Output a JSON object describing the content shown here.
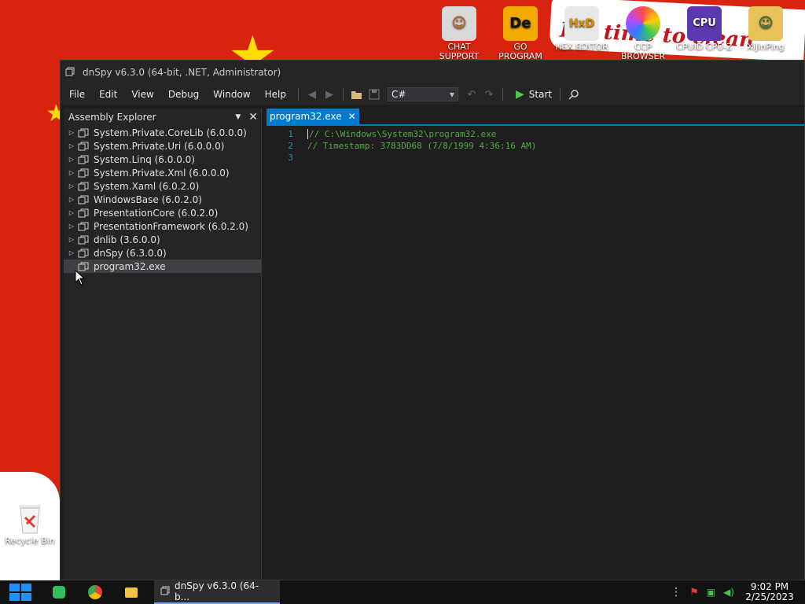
{
  "desktop": {
    "wallpaper_text": "It's time to clean",
    "icons": [
      {
        "label": "CHAT SUPPORT",
        "glyph": "☺",
        "color": "#d9d9d9"
      },
      {
        "label": "GO PROGRAM DIE VIEWER",
        "glyph": "De",
        "color": "#f2a900"
      },
      {
        "label": "HEX EDITOR",
        "glyph": "HxD",
        "color": "#e8e8e8"
      },
      {
        "label": "CCP BROWSER",
        "glyph": "◉",
        "color": "#ff9a2e"
      },
      {
        "label": "CPUID CPU-Z",
        "glyph": "CPU",
        "color": "#5b3ab0"
      },
      {
        "label": "XiJinPing",
        "glyph": "☺",
        "color": "#e8c15a"
      }
    ],
    "recycle_bin": "Recycle Bin"
  },
  "taskbar": {
    "app_label": "dnSpy v6.3.0 (64-b...",
    "time": "9:02 PM",
    "date": "2/25/2023"
  },
  "window": {
    "title": "dnSpy v6.3.0 (64-bit, .NET, Administrator)",
    "menu": [
      "File",
      "Edit",
      "View",
      "Debug",
      "Window",
      "Help"
    ],
    "language": "C#",
    "start_label": "Start"
  },
  "assembly_explorer": {
    "title": "Assembly Explorer",
    "items": [
      "System.Private.CoreLib (6.0.0.0)",
      "System.Private.Uri (6.0.0.0)",
      "System.Linq (6.0.0.0)",
      "System.Private.Xml (6.0.0.0)",
      "System.Xaml (6.0.2.0)",
      "WindowsBase (6.0.2.0)",
      "PresentationCore (6.0.2.0)",
      "PresentationFramework (6.0.2.0)",
      "dnlib (3.6.0.0)",
      "dnSpy (6.3.0.0)",
      "program32.exe"
    ]
  },
  "editor": {
    "tab_label": "program32.exe",
    "lines": [
      {
        "num": "1",
        "text": "// C:\\Windows\\System32\\program32.exe"
      },
      {
        "num": "2",
        "text": "// Timestamp: 3783DD68 (7/8/1999 4:36:16 AM)"
      },
      {
        "num": "3",
        "text": ""
      }
    ]
  },
  "colors": {
    "accent": "#007acc",
    "wallpaper": "#d8230f"
  }
}
